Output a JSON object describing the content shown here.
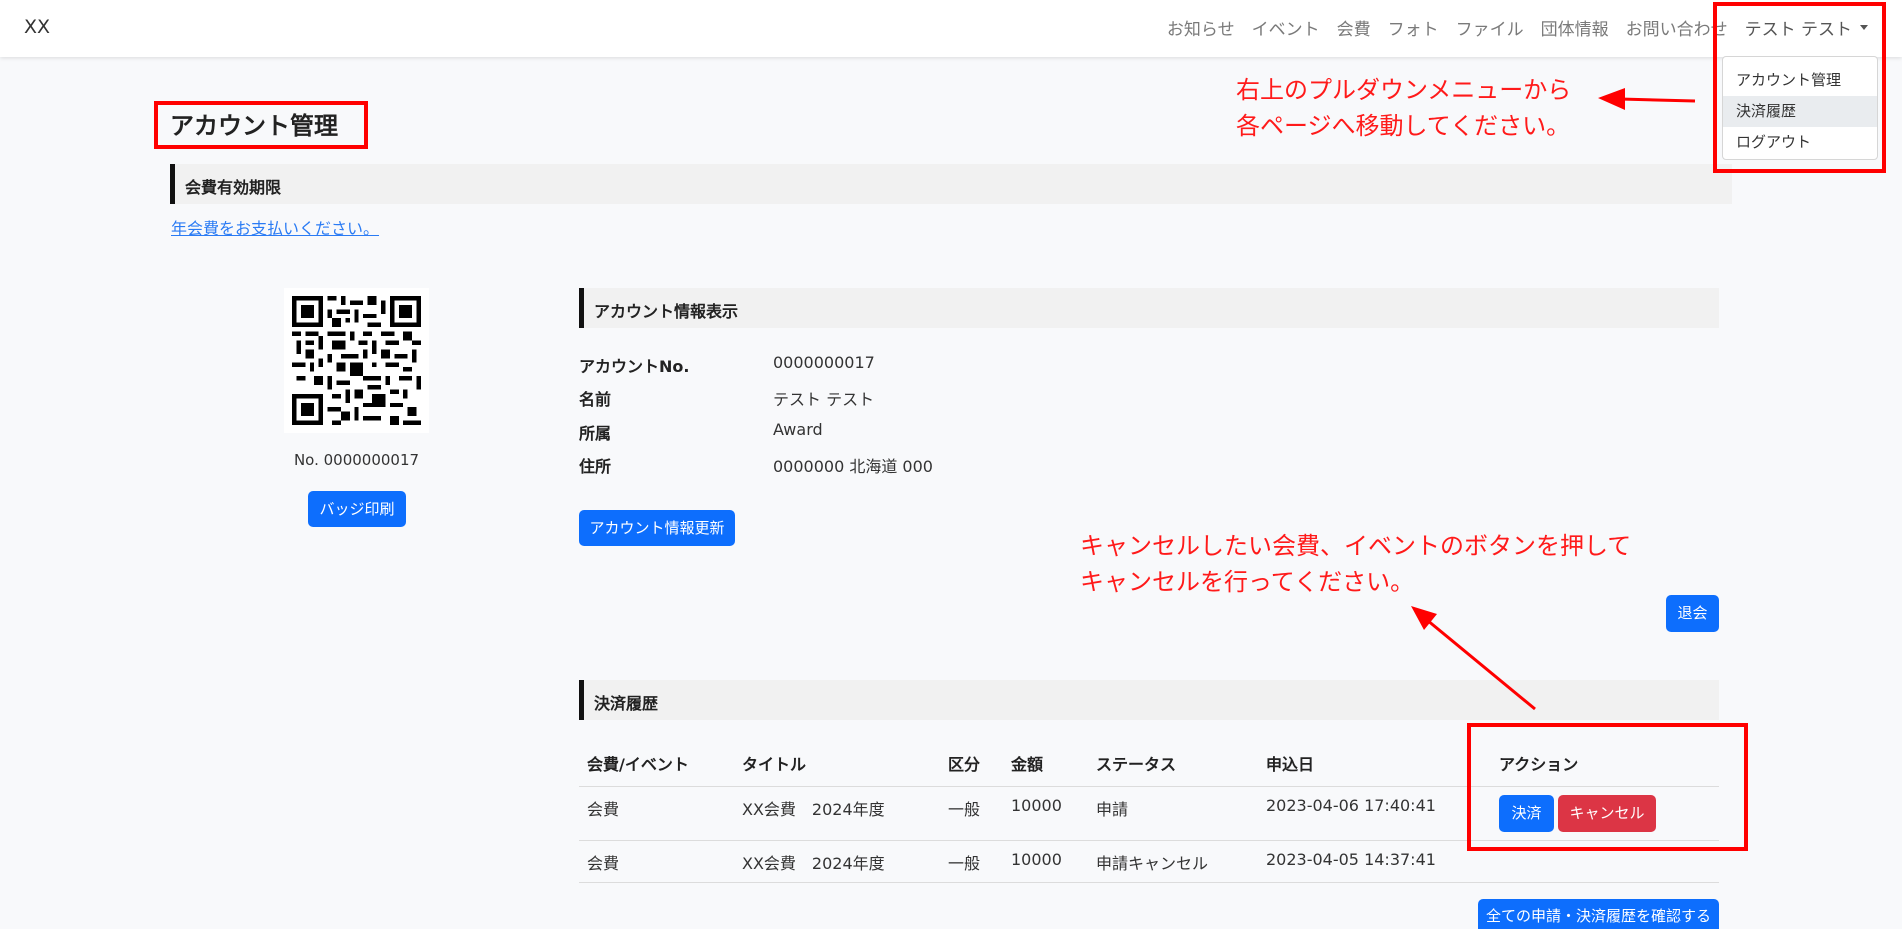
{
  "brand": "XX",
  "nav": {
    "links": [
      "お知らせ",
      "イベント",
      "会費",
      "フォト",
      "ファイル",
      "団体情報",
      "お問い合わせ"
    ],
    "user": "テスト テスト"
  },
  "dropdown": {
    "items": [
      "アカウント管理",
      "決済履歴",
      "ログアウト"
    ]
  },
  "annotations": {
    "top_line1": "右上のプルダウンメニューから",
    "top_line2": "各ページへ移動してください。",
    "mid_line1": "キャンセルしたい会費、イベントのボタンを押して",
    "mid_line2": "キャンセルを行ってください。",
    "color": "#ff0000"
  },
  "page_title": "アカウント管理",
  "membership": {
    "section_title": "会費有効期限",
    "pay_link": "年会費をお支払いください。"
  },
  "qr": {
    "number_text": "No. 0000000017",
    "badge_button": "バッジ印刷"
  },
  "account_info": {
    "section_title": "アカウント情報表示",
    "rows": [
      {
        "label": "アカウントNo.",
        "value": "0000000017"
      },
      {
        "label": "名前",
        "value": "テスト テスト"
      },
      {
        "label": "所属",
        "value": "Award"
      },
      {
        "label": "住所",
        "value": "0000000 北海道 000"
      }
    ],
    "update_button": "アカウント情報更新",
    "withdraw_button": "退会"
  },
  "payment_history": {
    "section_title": "決済履歴",
    "headers": [
      "会費/イベント",
      "タイトル",
      "区分",
      "金額",
      "ステータス",
      "申込日",
      "アクション"
    ],
    "rows": [
      {
        "type": "会費",
        "title": "XX会費　2024年度",
        "category": "一般",
        "amount": "10000",
        "status": "申請",
        "date": "2023-04-06 17:40:41"
      },
      {
        "type": "会費",
        "title": "XX会費　2024年度",
        "category": "一般",
        "amount": "10000",
        "status": "申請キャンセル",
        "date": "2023-04-05 14:37:41"
      }
    ],
    "pay_button": "決済",
    "cancel_button": "キャンセル",
    "all_history_button": "全ての申請・決済履歴を確認する"
  },
  "colors": {
    "primary": "#0d6efd",
    "danger": "#dc3545",
    "link": "#2a7bf4",
    "annotation": "#ff0000"
  }
}
